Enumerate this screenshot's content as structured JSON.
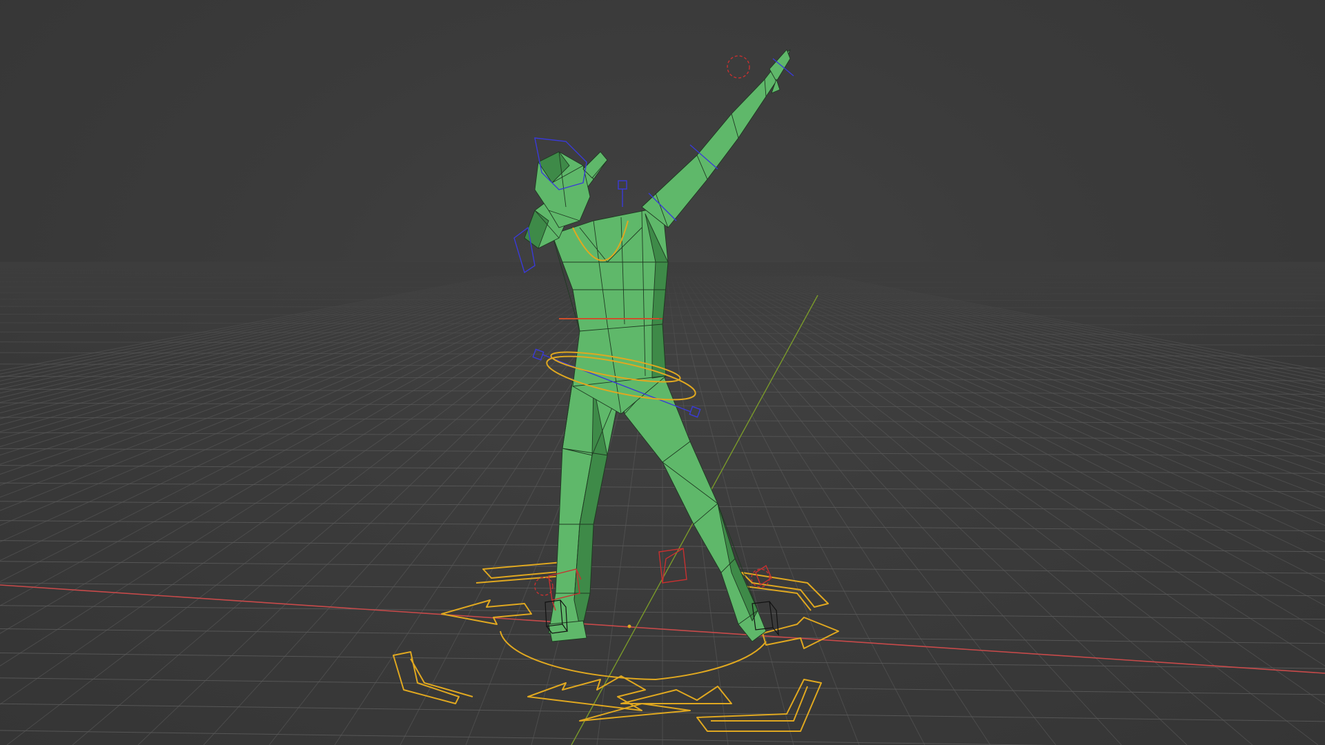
{
  "viewport": {
    "background_color": "#3c3c3c",
    "grid_line_color": "#5a5a5a",
    "x_axis_color": "#c84a4a",
    "y_axis_color": "#7a9a2a"
  },
  "character": {
    "mesh_color": "#5fb86a",
    "mesh_shadow_color": "#3e8a48",
    "wire_color": "#1f3a22",
    "pose": "dab"
  },
  "rig": {
    "root_control_color": "#e0a820",
    "ik_control_color": "#c83030",
    "fk_control_color": "#3a3ad8",
    "controls": [
      "root-move-arrows",
      "hip-rotation-ring",
      "chest-ring",
      "left-foot-ik-box",
      "right-foot-ik-box",
      "knee-pole-box",
      "hand-ik-gear",
      "head-control",
      "spine-line-handle"
    ]
  }
}
